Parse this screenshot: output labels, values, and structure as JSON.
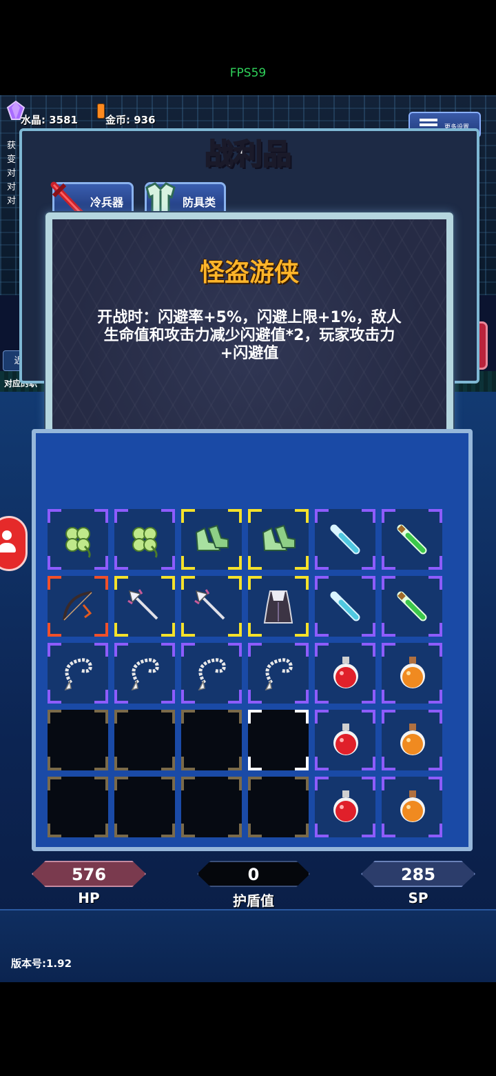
{
  "fps": "FPS59",
  "resources": {
    "crystal_label": "水晶: 3581",
    "gold_label": "金币: 936"
  },
  "more_settings_label": "更多设置",
  "side": {
    "texts": [
      "获",
      "变",
      "对",
      "对",
      "对"
    ],
    "item_label": "近",
    "note": "对应的职"
  },
  "loot": {
    "title": "战利品",
    "tabs": [
      {
        "label": "冷兵器",
        "icon": "sword-icon"
      },
      {
        "label": "防具类",
        "icon": "armor-icon"
      }
    ]
  },
  "tooltip": {
    "title": "怪盗游侠",
    "description_lines": [
      "开战时：闪避率+5%，闪避上限+1%，敌人",
      "生命值和攻击力减少闪避值*2，玩家攻击力",
      "+闪避值"
    ],
    "set_items": [
      {
        "icon": "grapple-icon",
        "rarity": "red"
      },
      {
        "icon": "golden-dagger-icon",
        "rarity": "red"
      },
      {
        "icon": "hooded-cloak-icon",
        "rarity": "purple"
      }
    ]
  },
  "inventory": {
    "rows": [
      [
        {
          "icon": "clover-icon",
          "rarity": "purple"
        },
        {
          "icon": "clover-icon",
          "rarity": "purple"
        },
        {
          "icon": "green-boots-icon",
          "rarity": "yellow"
        },
        {
          "icon": "green-boots-icon",
          "rarity": "yellow"
        },
        {
          "icon": "blue-vial-icon",
          "rarity": "purple"
        },
        {
          "icon": "green-vial-icon",
          "rarity": "purple"
        }
      ],
      [
        {
          "icon": "bow-icon",
          "rarity": "red"
        },
        {
          "icon": "trident-icon",
          "rarity": "yellow"
        },
        {
          "icon": "trident-icon",
          "rarity": "yellow"
        },
        {
          "icon": "hooded-cloak-icon",
          "rarity": "yellow"
        },
        {
          "icon": "blue-vial-icon",
          "rarity": "purple"
        },
        {
          "icon": "green-vial-icon",
          "rarity": "purple"
        }
      ],
      [
        {
          "icon": "whip-icon",
          "rarity": "purple"
        },
        {
          "icon": "whip-icon",
          "rarity": "purple"
        },
        {
          "icon": "whip-icon",
          "rarity": "purple"
        },
        {
          "icon": "whip-icon",
          "rarity": "purple"
        },
        {
          "icon": "red-potion-icon",
          "rarity": "purple"
        },
        {
          "icon": "orange-potion-icon",
          "rarity": "purple"
        }
      ],
      [
        {
          "icon": "",
          "rarity": "empty"
        },
        {
          "icon": "",
          "rarity": "empty"
        },
        {
          "icon": "",
          "rarity": "empty"
        },
        {
          "icon": "",
          "rarity": "selected"
        },
        {
          "icon": "red-potion-icon",
          "rarity": "purple"
        },
        {
          "icon": "orange-potion-icon",
          "rarity": "purple"
        }
      ],
      [
        {
          "icon": "",
          "rarity": "empty"
        },
        {
          "icon": "",
          "rarity": "empty"
        },
        {
          "icon": "",
          "rarity": "empty"
        },
        {
          "icon": "",
          "rarity": "empty"
        },
        {
          "icon": "red-potion-icon",
          "rarity": "purple"
        },
        {
          "icon": "orange-potion-icon",
          "rarity": "purple"
        }
      ]
    ]
  },
  "stats": {
    "hp_value": "576",
    "hp_label": "HP",
    "shield_value": "0",
    "shield_label": "护盾值",
    "sp_value": "285",
    "sp_label": "SP"
  },
  "version": "版本号:1.92",
  "colors": {
    "purple": "#8e5cff",
    "yellow": "#f5e12a",
    "red": "#f0502a",
    "empty": "#7a6a4a",
    "selected": "#ffffff",
    "tooltip_title": "#ffb52a",
    "hp_pill": "#7a3a4e",
    "shield_pill": "#05070c",
    "sp_pill": "#2c3d6b"
  }
}
